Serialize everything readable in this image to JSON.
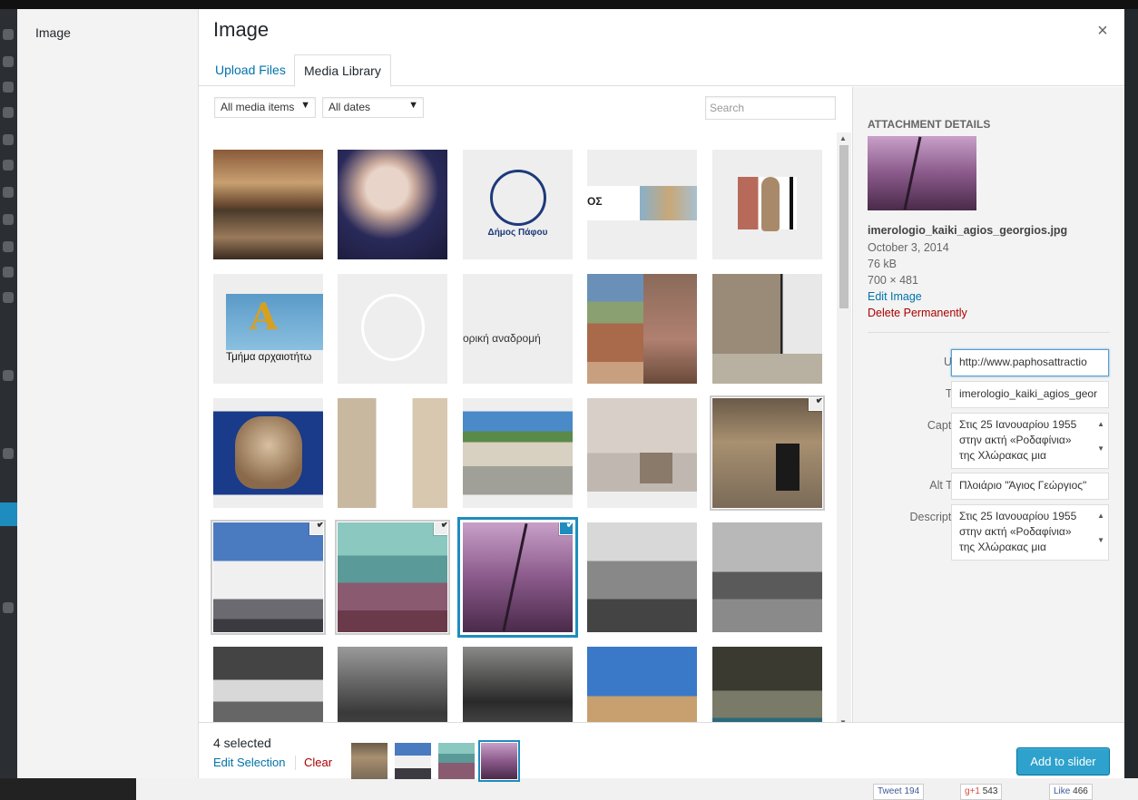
{
  "menu": {
    "title": "Image"
  },
  "frame": {
    "title": "Image",
    "close": "×"
  },
  "tabs": [
    {
      "label": "Upload Files"
    },
    {
      "label": "Media Library"
    }
  ],
  "filters": {
    "type": "All media items",
    "date": "All dates",
    "search_placeholder": "Search"
  },
  "grid": {
    "items": [
      {
        "name": "grid-item-church-frescoes",
        "selected": false
      },
      {
        "name": "grid-item-old-man-portrait",
        "selected": false
      },
      {
        "name": "grid-item-dimos-pafou-logo",
        "selected": false,
        "text": "Δήμος Πάφου"
      },
      {
        "name": "grid-item-banner-ruins",
        "selected": false,
        "text": "ΟΣ"
      },
      {
        "name": "grid-item-statue",
        "selected": false
      },
      {
        "name": "grid-item-archaeology-dept-logo",
        "selected": false,
        "text": "Τμήμα αρχαιοτήτω"
      },
      {
        "name": "grid-item-coin-white",
        "selected": false
      },
      {
        "name": "grid-item-text-banner",
        "selected": false,
        "text": "ορική αναδρομή"
      },
      {
        "name": "grid-item-building-collage",
        "selected": false
      },
      {
        "name": "grid-item-stone-house",
        "selected": false
      },
      {
        "name": "grid-item-amphora",
        "selected": false
      },
      {
        "name": "grid-item-stone-wall",
        "selected": false
      },
      {
        "name": "grid-item-museum-building",
        "selected": false
      },
      {
        "name": "grid-item-museum-hall",
        "selected": false
      },
      {
        "name": "grid-item-cave-gate",
        "selected": true
      },
      {
        "name": "grid-item-seafront-building",
        "selected": true
      },
      {
        "name": "grid-item-rocky-coast",
        "selected": true
      },
      {
        "name": "grid-item-kaiki-agios-georgios",
        "selected": true,
        "details": true
      },
      {
        "name": "grid-item-parade",
        "selected": false
      },
      {
        "name": "grid-item-warship",
        "selected": false
      },
      {
        "name": "grid-item-crowd-stadium",
        "selected": false
      },
      {
        "name": "grid-item-group-photo",
        "selected": false
      },
      {
        "name": "grid-item-family-photo",
        "selected": false
      },
      {
        "name": "grid-item-column-capital",
        "selected": false
      },
      {
        "name": "grid-item-sea-cave",
        "selected": false
      }
    ],
    "check_glyph": "✔"
  },
  "attachment": {
    "heading": "Attachment Details",
    "filename": "imerologio_kaiki_agios_georgios.jpg",
    "date": "October 3, 2014",
    "size": "76 kB",
    "dimensions": "700 × 481",
    "edit_link": "Edit Image",
    "delete_link": "Delete Permanently",
    "fields": {
      "url": {
        "label": "URL",
        "value": "http://www.paphosattractio"
      },
      "title": {
        "label": "Title",
        "value": "imerologio_kaiki_agios_geor"
      },
      "caption": {
        "label": "Caption",
        "value": "Στις 25 Ιανουαρίου 1955 στην ακτή «Ροδαφίνια» της Χλώρακας μια"
      },
      "alt": {
        "label": "Alt Text",
        "value": "Πλοιάριο \"Άγιος Γεώργιος\""
      },
      "description": {
        "label": "Description",
        "value": "Στις 25 Ιανουαρίου 1955 στην ακτή «Ροδαφίνια» της Χλώρακας μια"
      }
    }
  },
  "selection": {
    "count": "4 selected",
    "edit": "Edit Selection",
    "clear": "Clear"
  },
  "primary_button": "Add to slider",
  "background": {
    "tweet": "Tweet",
    "tweet_count": "194",
    "gplus": "g+1",
    "gplus_count": "543",
    "like": "Like",
    "like_count": "466"
  },
  "colors": {
    "accent": "#1e8cbe",
    "button": "#2ea2cc",
    "danger": "#aa0000"
  }
}
